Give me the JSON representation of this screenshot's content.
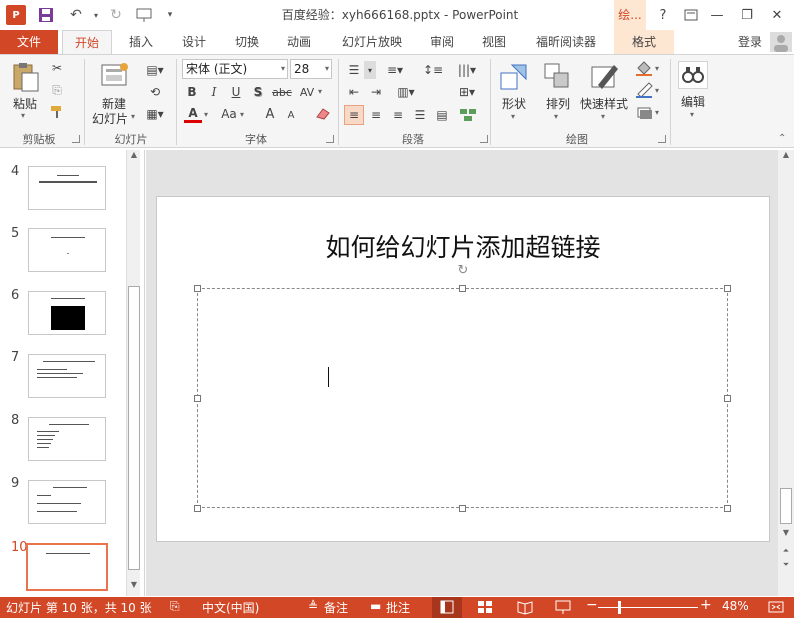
{
  "titlebar": {
    "title": "百度经验：xyh666168.pptx - PowerPoint",
    "help": "?",
    "ctx_draw": "绘...",
    "ctx_format": "格式"
  },
  "tabs": [
    {
      "label": "文件"
    },
    {
      "label": "开始"
    },
    {
      "label": "插入"
    },
    {
      "label": "设计"
    },
    {
      "label": "切换"
    },
    {
      "label": "动画"
    },
    {
      "label": "幻灯片放映"
    },
    {
      "label": "审阅"
    },
    {
      "label": "视图"
    },
    {
      "label": "福昕阅读器"
    },
    {
      "label": "格式"
    }
  ],
  "account": {
    "login": "登录"
  },
  "ribbon": {
    "clipboard": {
      "paste": "粘贴",
      "group": "剪贴板"
    },
    "slides": {
      "new_slide_line1": "新建",
      "new_slide_line2": "幻灯片",
      "group": "幻灯片"
    },
    "font": {
      "name": "宋体 (正文)",
      "size": "28",
      "bold": "B",
      "italic": "I",
      "underline": "U",
      "shadow": "S",
      "strike": "abc",
      "spacing": "AV",
      "color": "A",
      "case": "Aa",
      "grow": "A",
      "shrink": "A",
      "group": "字体"
    },
    "paragraph": {
      "group": "段落"
    },
    "drawing": {
      "shape": "形状",
      "arrange": "排列",
      "quick_style": "快速样式",
      "group": "绘图"
    },
    "editing": {
      "label": "编辑"
    }
  },
  "thumbnails": [
    {
      "num": "4"
    },
    {
      "num": "5"
    },
    {
      "num": "6"
    },
    {
      "num": "7"
    },
    {
      "num": "8"
    },
    {
      "num": "9"
    },
    {
      "num": "10"
    }
  ],
  "slide": {
    "title": "如何给幻灯片添加超链接"
  },
  "statusbar": {
    "slide_info": "幻灯片 第 10 张，共 10 张",
    "language": "中文(中国)",
    "notes": "备注",
    "comments": "批注",
    "zoom": "48%"
  },
  "colors": {
    "accent": "#d24726",
    "ribbon_bg": "#f5f5f5",
    "workspace": "#e3e3e3"
  }
}
